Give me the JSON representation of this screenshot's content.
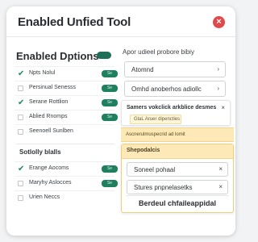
{
  "window": {
    "title": "Enabled Unfied Tool",
    "close_glyph": "×"
  },
  "left": {
    "header": "Enabled Dptions",
    "rows": [
      {
        "label": "Npts Nolul",
        "checked": true,
        "pill": "Se"
      },
      {
        "label": "Persinual Senesss",
        "checked": false,
        "pill": "Se"
      },
      {
        "label": "Serane Rottlion",
        "checked": true,
        "pill": "Se"
      },
      {
        "label": "Ablied Rnomps",
        "checked": false,
        "pill": "Se"
      },
      {
        "label": "Seenoell Sunlben",
        "checked": false,
        "pill": ""
      }
    ],
    "subsection": "Sotlolly blalls",
    "rows2": [
      {
        "label": "Erange Aocoms",
        "checked": true,
        "pill": "Se"
      },
      {
        "label": "Maryhy Aslocces",
        "checked": false,
        "pill": "Se"
      },
      {
        "label": "Urien Neccs",
        "checked": false,
        "pill": ""
      }
    ]
  },
  "right": {
    "header": "Apor udieel probore bibiy",
    "field1": "Atomnd",
    "field2": "Omhd anoberhos adiollc",
    "panel_title": "Samers vokclick arkblice desmes",
    "chip": "GlaL Aruer dipencties",
    "notice": "Ascnerulmuspecrid ad lomit",
    "warn_title": "Shepodalcis",
    "wfield1": "Soneel pohaal",
    "wfield2": "Stures pnpnelasetks",
    "button": "Berdeul chfaileappidal",
    "chev": "›",
    "x": "×"
  },
  "colors": {
    "accent": "#1f8060",
    "close": "#e04a4a",
    "warning_bg": "#fde9b8"
  }
}
